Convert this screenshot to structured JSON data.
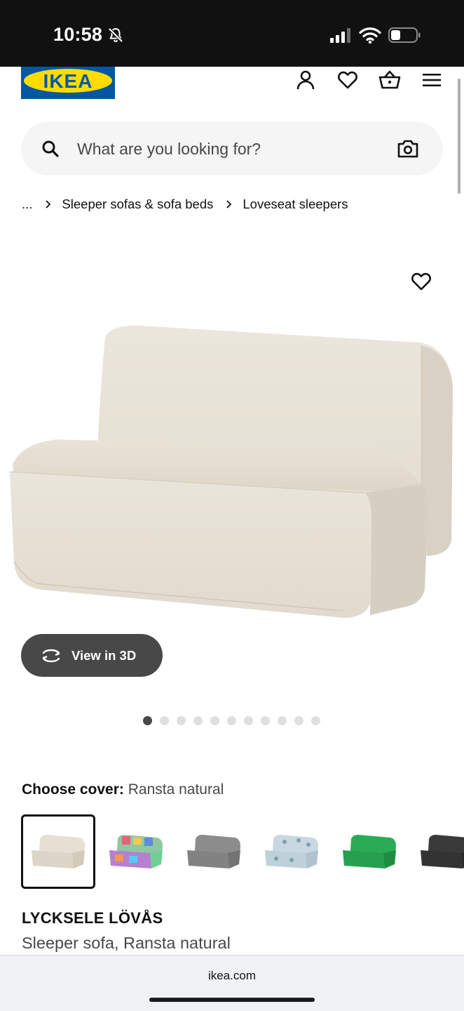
{
  "status_bar": {
    "time": "10:58",
    "icons": [
      "bell-slash-icon",
      "cellular-signal-icon",
      "wifi-icon",
      "battery-icon"
    ]
  },
  "header": {
    "logo_text": "IKEA",
    "icons": [
      "account-icon",
      "wishlist-heart-icon",
      "shopping-basket-icon",
      "menu-icon"
    ]
  },
  "search": {
    "placeholder": "What are you looking for?",
    "value": "",
    "icons": [
      "search-icon",
      "camera-icon"
    ]
  },
  "breadcrumb": {
    "items": [
      "...",
      "Sleeper sofas & sofa beds",
      "Loveseat sleepers"
    ]
  },
  "product": {
    "view_3d_label": "View in 3D",
    "carousel": {
      "count": 11,
      "active_index": 0
    },
    "choose_cover_label": "Choose cover:",
    "choose_cover_value": "Ransta natural",
    "cover_options": [
      {
        "name": "Ransta natural",
        "color": "#e6e0d4",
        "selected": true
      },
      {
        "name": "multicolor patchwork",
        "color": "#8fc7a0",
        "selected": false
      },
      {
        "name": "grey",
        "color": "#8c8c8c",
        "selected": false
      },
      {
        "name": "light blue pattern",
        "color": "#c9d8e0",
        "selected": false
      },
      {
        "name": "green",
        "color": "#2bab55",
        "selected": false
      },
      {
        "name": "dark grey",
        "color": "#3a3a3a",
        "selected": false
      }
    ],
    "name": "LYCKSELE LÖVÅS",
    "description": "Sleeper sofa, Ransta natural"
  },
  "browser": {
    "url": "ikea.com"
  },
  "colors": {
    "ikea_blue": "#0058a3",
    "ikea_yellow": "#ffdb00",
    "dark_button": "#484848"
  }
}
